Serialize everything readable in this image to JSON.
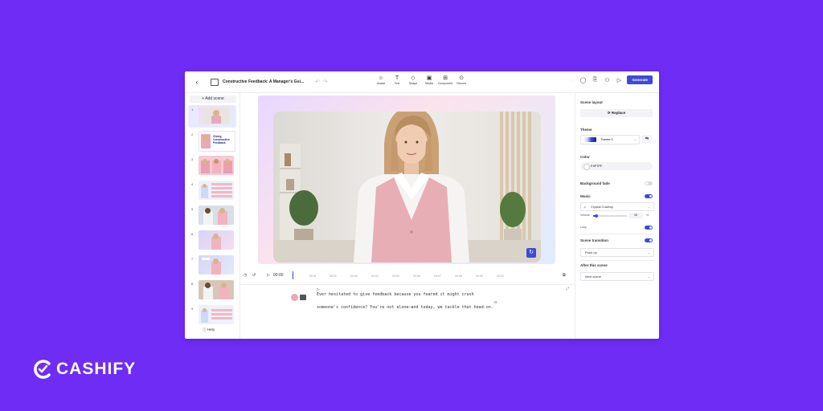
{
  "topbar": {
    "title": "Constructive Feedback: A Manager's Gui...",
    "tools": [
      {
        "icon": "avatar-icon",
        "glyph": "☺",
        "label": "Avatar"
      },
      {
        "icon": "text-icon",
        "glyph": "T",
        "label": "Text"
      },
      {
        "icon": "shape-icon",
        "glyph": "◇",
        "label": "Shape"
      },
      {
        "icon": "media-icon",
        "glyph": "▣",
        "label": "Media"
      },
      {
        "icon": "component-icon",
        "glyph": "⊞",
        "label": "Component"
      },
      {
        "icon": "record-icon",
        "glyph": "⊙",
        "label": "Record"
      }
    ],
    "generate_label": "Generate"
  },
  "left": {
    "add_scene_label": "+ Add scene",
    "scene_numbers": [
      "1",
      "2",
      "3",
      "4",
      "5",
      "6",
      "7",
      "8",
      "9"
    ],
    "scene2_text": "Giving Constructive Feedback",
    "help_label": "Help"
  },
  "timeline": {
    "time": "00:00",
    "ticks": [
      "0",
      "00:01",
      "00:02",
      "00:03",
      "00:04",
      "00:05",
      "00:06",
      "00:07",
      "00:08",
      "00:09",
      "00:10"
    ]
  },
  "script": {
    "line1": "Ever hesitated to give feedback because you feared it might crush",
    "line2": "someone's confidence? You're not alone—and today, we tackle that head-on."
  },
  "right": {
    "scene_layout_label": "Scene layout",
    "replace_label": "Replace",
    "theme_label": "Theme",
    "theme_value": "Theme 1",
    "color_label": "Color",
    "color_value": "F4F7FF",
    "bg_fade_label": "Background fade",
    "music_label": "Music",
    "music_value": "Crystal Cowboy",
    "volume_label": "Volume",
    "volume_value": "10",
    "volume_pct": "%",
    "loop_label": "Loop",
    "scene_transition_label": "Scene transition",
    "transition_value": "Push up",
    "after_scene_label": "After this scene",
    "after_scene_value": "Next scene"
  },
  "controls": {
    "background_fade_on": false,
    "music_on": true,
    "loop_on": true,
    "scene_transition_on": true,
    "volume_fraction": 0.1
  },
  "brand": {
    "name": "CASHIFY"
  },
  "colors": {
    "background": "#6f2cf5",
    "accent": "#3c4bd8"
  }
}
